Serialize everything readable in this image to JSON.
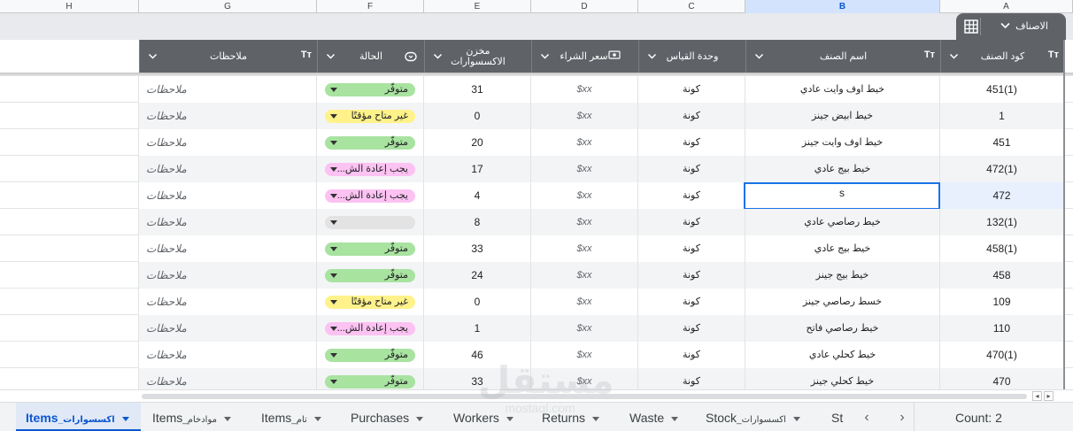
{
  "column_letters": [
    "H",
    "G",
    "F",
    "E",
    "D",
    "C",
    "B",
    "A"
  ],
  "table": {
    "name": "الاصناف",
    "headers": {
      "code": "كود الصنف",
      "name": "اسم الصنف",
      "unit": "وحدة القياس",
      "price": "سعر الشراء",
      "stock": "مخزن الاكسسوارات",
      "status": "الحالة",
      "notes": "ملاحظات"
    },
    "type_icon": "Tт"
  },
  "rows": [
    {
      "code": "451(1)",
      "name": "خيط اوف وايت عادي",
      "unit": "كونة",
      "price": "$xx",
      "stock": "31",
      "status": "متوفّر",
      "status_color": "green",
      "notes": "ملاحظات"
    },
    {
      "code": "1",
      "name": "خيط ابيض جينز",
      "unit": "كونة",
      "price": "$xx",
      "stock": "0",
      "status": "غير متاح مؤقتًا",
      "status_color": "yellow",
      "notes": "ملاحظات"
    },
    {
      "code": "451",
      "name": "خيط اوف وايت جينز",
      "unit": "كونة",
      "price": "$xx",
      "stock": "20",
      "status": "متوفّر",
      "status_color": "green",
      "notes": "ملاحظات"
    },
    {
      "code": "472(1)",
      "name": "خيط بيج عادي",
      "unit": "كونة",
      "price": "$xx",
      "stock": "17",
      "status": "يجب إعادة الش...",
      "status_color": "pink",
      "notes": "ملاحظات"
    },
    {
      "code": "472",
      "name": "s",
      "unit": "كونة",
      "price": "$xx",
      "stock": "4",
      "status": "يجب إعادة الش...",
      "status_color": "pink",
      "notes": "ملاحظات"
    },
    {
      "code": "132(1)",
      "name": "خيط رصاصي عادي",
      "unit": "كونة",
      "price": "$xx",
      "stock": "8",
      "status": "",
      "status_color": "gray",
      "notes": "ملاحظات"
    },
    {
      "code": "458(1)",
      "name": "خيط بيج عادي",
      "unit": "كونة",
      "price": "$xx",
      "stock": "33",
      "status": "متوفّر",
      "status_color": "green",
      "notes": "ملاحظات"
    },
    {
      "code": "458",
      "name": "خيط بيج جينز",
      "unit": "كونة",
      "price": "$xx",
      "stock": "24",
      "status": "متوفّر",
      "status_color": "green",
      "notes": "ملاحظات"
    },
    {
      "code": "109",
      "name": "خسط رصاصي جينز",
      "unit": "كونة",
      "price": "$xx",
      "stock": "0",
      "status": "غير متاح مؤقتًا",
      "status_color": "yellow",
      "notes": "ملاحظات"
    },
    {
      "code": "110",
      "name": "خيط رصاصي فاتح",
      "unit": "كونة",
      "price": "$xx",
      "stock": "1",
      "status": "يجب إعادة الش...",
      "status_color": "pink",
      "notes": "ملاحظات"
    },
    {
      "code": "470(1)",
      "name": "خيط كحلي عادي",
      "unit": "كونة",
      "price": "$xx",
      "stock": "46",
      "status": "متوفّر",
      "status_color": "green",
      "notes": "ملاحظات"
    },
    {
      "code": "470",
      "name": "خيط كحلي جينز",
      "unit": "كونة",
      "price": "$xx",
      "stock": "33",
      "status": "متوفّر",
      "status_color": "green",
      "notes": "ملاحظات"
    }
  ],
  "selected_row_index": 4,
  "sheet_tabs": [
    {
      "en": "Items",
      "ar": "_اكسسوارات",
      "active": true
    },
    {
      "en": "Items",
      "ar": "_موادخام",
      "active": false
    },
    {
      "en": "Items",
      "ar": "_تام",
      "active": false
    },
    {
      "en": "Purchases",
      "ar": "",
      "active": false
    },
    {
      "en": "Workers",
      "ar": "",
      "active": false
    },
    {
      "en": "Returns",
      "ar": "",
      "active": false
    },
    {
      "en": "Waste",
      "ar": "",
      "active": false
    },
    {
      "en": "Stock",
      "ar": "_اكسسوارات",
      "active": false
    },
    {
      "en": "St",
      "ar": "",
      "active": false
    }
  ],
  "status_bar": {
    "count": "Count: 2"
  },
  "watermark": {
    "main": "مستقل",
    "sub": "mostaql.com"
  },
  "colors": {
    "header_bg": "#5f6368",
    "chip_green": "#a8e3a0",
    "chip_yellow": "#fff28a",
    "chip_pink": "#fcc2f2",
    "chip_gray": "#e3e3e3",
    "selection": "#1a73e8",
    "active_tab": "#0b57d0"
  }
}
